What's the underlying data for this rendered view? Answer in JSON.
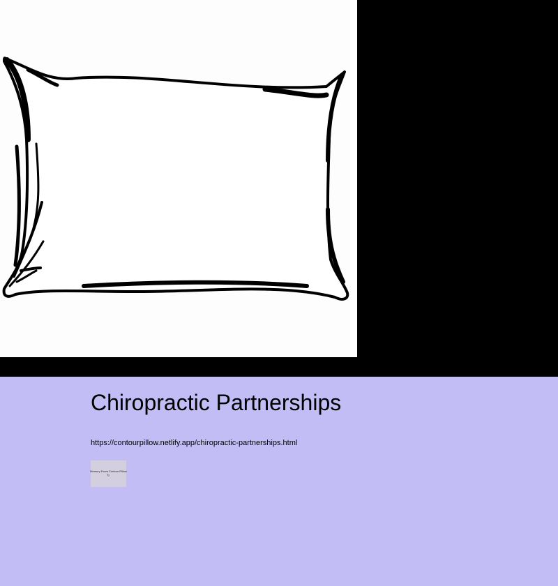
{
  "hero": {
    "image": "pillow-outline-illustration",
    "background": "#000000"
  },
  "content": {
    "background": "#c3bdf5",
    "title": "Chiropractic Partnerships",
    "url": "https://contourpillow.netlify.app/chiropractic-partnerships.html",
    "thumbnail": {
      "label": "Memory Foam Contour Pillow",
      "icon": "reload-icon",
      "icon_glyph": "↻"
    }
  }
}
